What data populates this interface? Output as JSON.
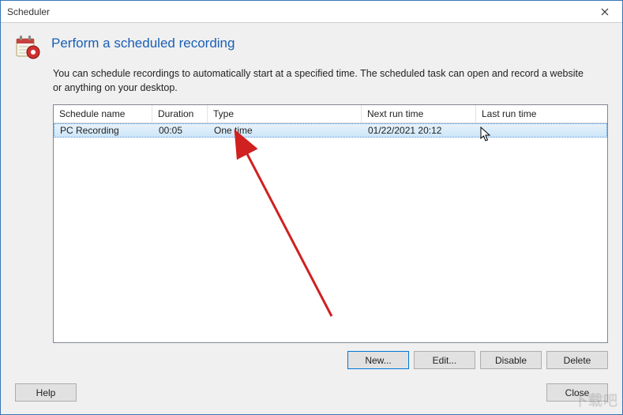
{
  "window": {
    "title": "Scheduler"
  },
  "header": {
    "title": "Perform a scheduled recording"
  },
  "description": "You can schedule recordings to automatically start at a specified time.  The scheduled task can open and record a website or anything on your desktop.",
  "table": {
    "columns": {
      "name": "Schedule name",
      "duration": "Duration",
      "type": "Type",
      "next_run": "Next run time",
      "last_run": "Last run time"
    },
    "rows": [
      {
        "name": "PC Recording",
        "duration": "00:05",
        "type": "One time",
        "next_run": "01/22/2021 20:12",
        "last_run": ""
      }
    ]
  },
  "buttons": {
    "new": "New...",
    "edit": "Edit...",
    "disable": "Disable",
    "delete": "Delete",
    "help": "Help",
    "close": "Close"
  },
  "watermark": "下载吧"
}
